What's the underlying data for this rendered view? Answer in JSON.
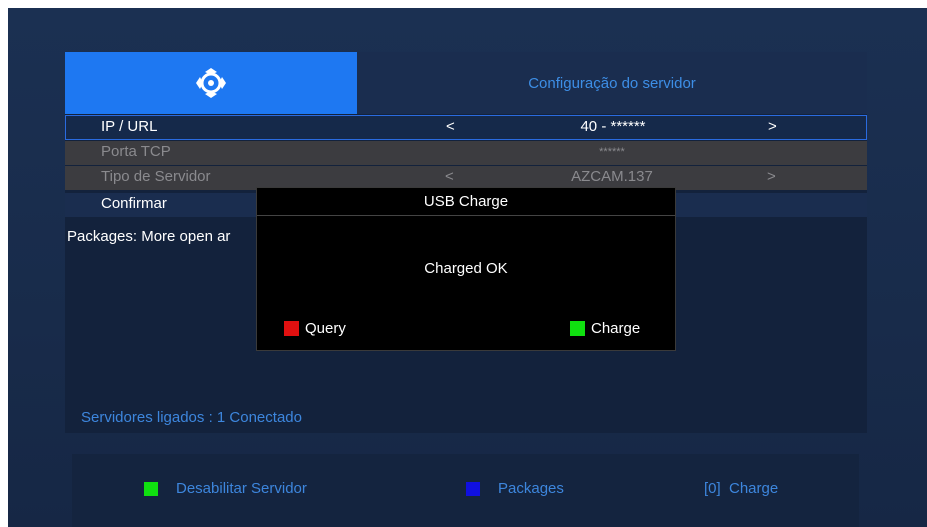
{
  "header": {
    "logo_icon": "shield-swirl-icon",
    "title": "Configuração do servidor"
  },
  "settings": {
    "rows": [
      {
        "label": "IP / URL",
        "value": "40 - ******",
        "left": "<",
        "right": ">"
      },
      {
        "label": "Porta TCP",
        "value": "******"
      },
      {
        "label": "Tipo de Servidor",
        "value": "AZCAM.137",
        "left": "<",
        "right": ">"
      },
      {
        "label": "Confirmar"
      }
    ]
  },
  "packages_text": "Packages: More open ar",
  "status_text": "Servidores ligados : 1   Conectado",
  "dialog": {
    "title": "USB Charge",
    "message": "Charged OK",
    "query_label": "Query",
    "charge_label": "Charge",
    "query_color": "#e01010",
    "charge_color": "#10e010"
  },
  "footer": {
    "keys": [
      {
        "label": "Desabilitar Servidor",
        "color": "#10e010"
      },
      {
        "label": "Packages",
        "color": "#1010e0"
      },
      {
        "label": "[0]  Charge"
      }
    ]
  }
}
